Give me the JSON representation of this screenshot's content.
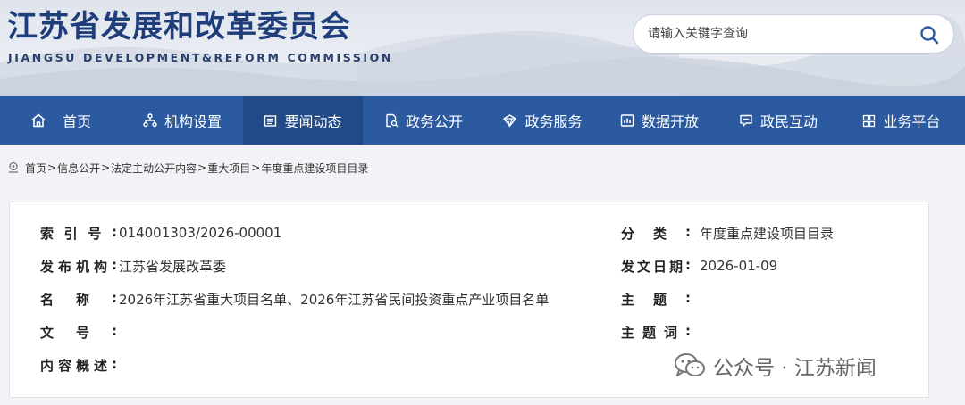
{
  "header": {
    "title": "江苏省发展和改革委员会",
    "subtitle": "JIANGSU DEVELOPMENT&REFORM COMMISSION",
    "search_placeholder": "请输入关键字查询"
  },
  "nav": {
    "items": [
      {
        "label": "首页",
        "icon": "home-icon"
      },
      {
        "label": "机构设置",
        "icon": "org-structure-icon"
      },
      {
        "label": "要闻动态",
        "icon": "news-icon"
      },
      {
        "label": "政务公开",
        "icon": "document-search-icon"
      },
      {
        "label": "政务服务",
        "icon": "service-icon"
      },
      {
        "label": "数据开放",
        "icon": "data-chart-icon"
      },
      {
        "label": "政民互动",
        "icon": "chat-icon"
      },
      {
        "label": "业务平台",
        "icon": "grid-icon"
      }
    ],
    "active_index": 2
  },
  "breadcrumb": {
    "items": [
      "首页",
      "信息公开",
      "法定主动公开内容",
      "重大项目",
      "年度重点建设项目目录"
    ],
    "separator": ">"
  },
  "info": {
    "index_label": "索引号:",
    "index_value": "014001303/2026-00001",
    "category_label": "分类:",
    "category_value": "年度重点建设项目目录",
    "publisher_label": "发布机构:",
    "publisher_value": "江苏省发展改革委",
    "date_label": "发文日期:",
    "date_value": "2026-01-09",
    "name_label": "名称:",
    "name_value": "2026年江苏省重大项目名单、2026年江苏省民间投资重点产业项目名单",
    "subject_label": "主题:",
    "subject_value": "",
    "docno_label": "文号:",
    "docno_value": "",
    "keywords_label": "主题词:",
    "keywords_value": "",
    "summary_label": "内容概述:",
    "summary_value": ""
  },
  "watermark": {
    "text": "公众号 · 江苏新闻"
  },
  "colors": {
    "nav_bg": "#2c5aa0",
    "nav_active": "#214a88",
    "title": "#1f3d7a"
  }
}
